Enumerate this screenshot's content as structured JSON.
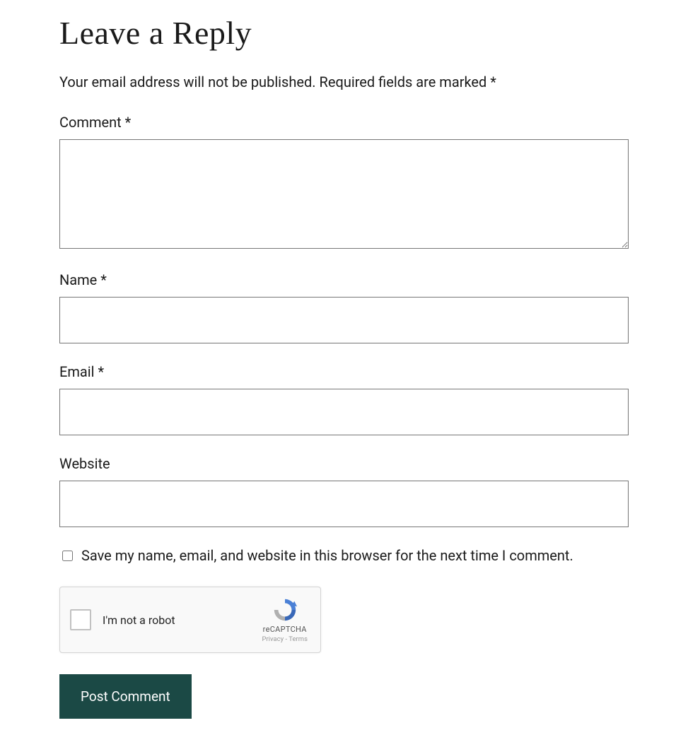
{
  "heading": "Leave a Reply",
  "notice_prefix": "Your email address will not be published.",
  "notice_required": "Required fields are marked *",
  "fields": {
    "comment": {
      "label": "Comment *",
      "value": ""
    },
    "name": {
      "label": "Name *",
      "value": ""
    },
    "email": {
      "label": "Email *",
      "value": ""
    },
    "website": {
      "label": "Website",
      "value": ""
    }
  },
  "save_checkbox": {
    "label": "Save my name, email, and website in this browser for the next time I comment.",
    "checked": false
  },
  "recaptcha": {
    "label": "I'm not a robot",
    "brand": "reCAPTCHA",
    "privacy": "Privacy",
    "separator": " - ",
    "terms": "Terms"
  },
  "submit_label": "Post Comment"
}
